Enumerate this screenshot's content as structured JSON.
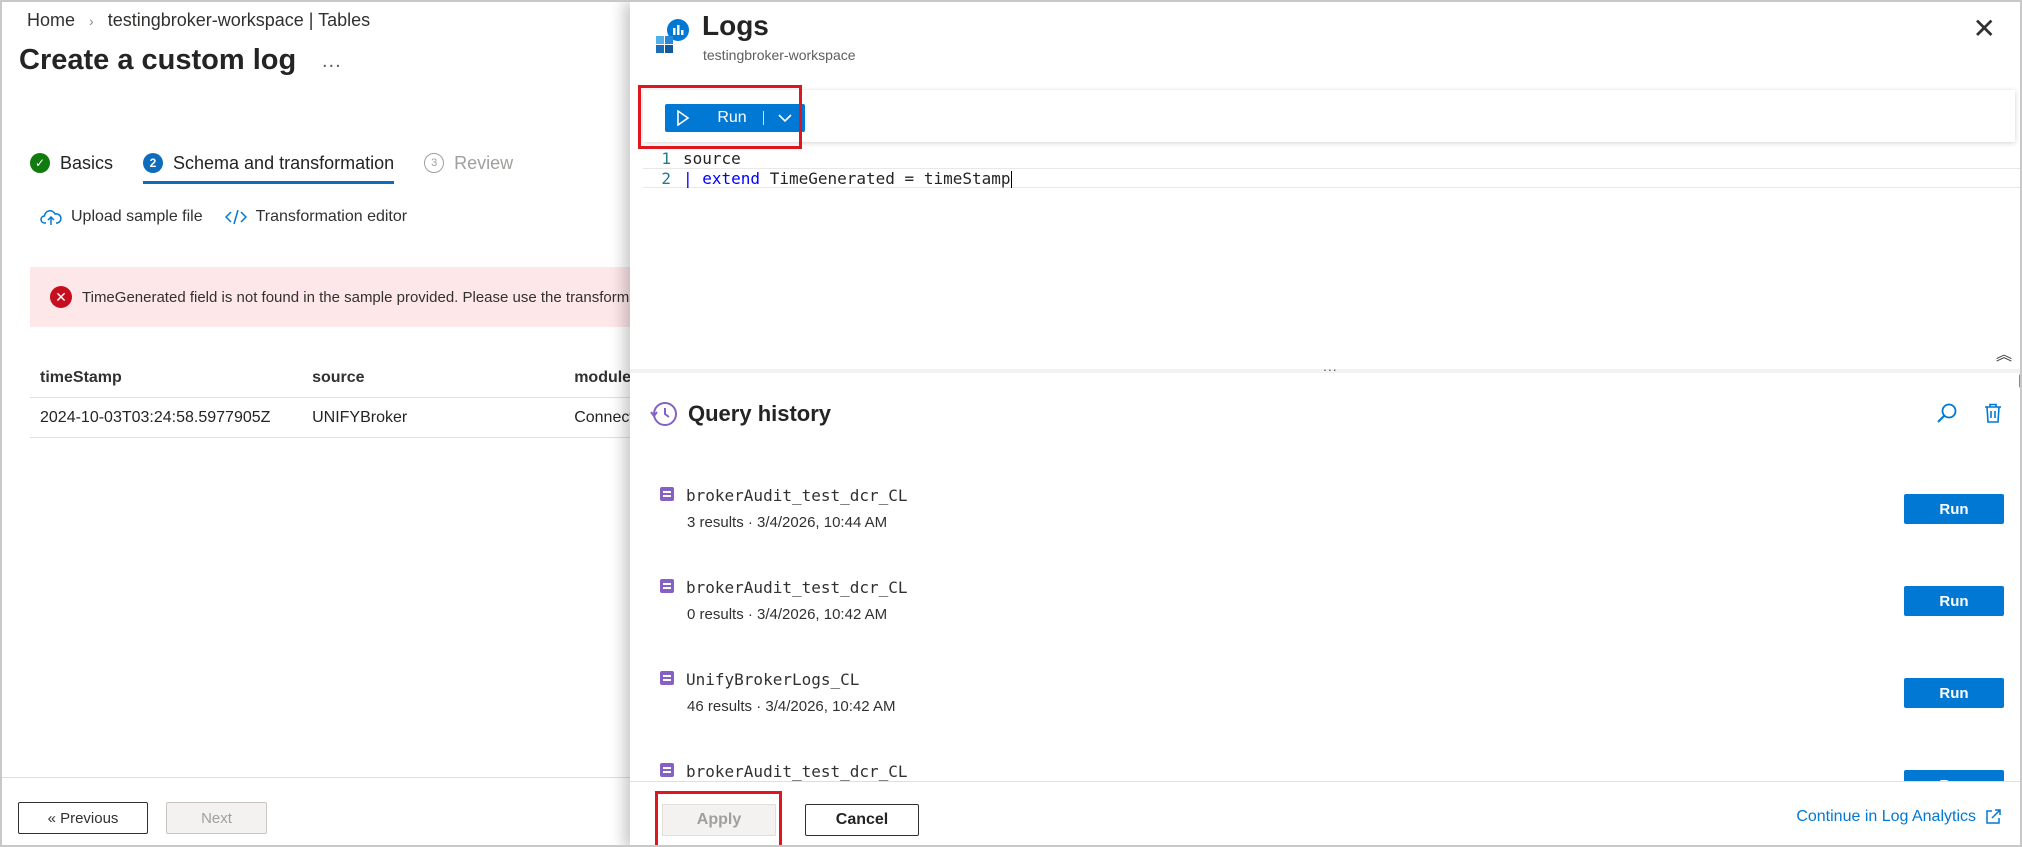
{
  "breadcrumb": {
    "home": "Home",
    "workspace": "testingbroker-workspace | Tables"
  },
  "page": {
    "title": "Create a custom log",
    "more": "..."
  },
  "tabs": [
    {
      "label": "Basics",
      "badge": "✓"
    },
    {
      "label": "Schema and transformation",
      "badge": "2"
    },
    {
      "label": "Review",
      "badge": "3"
    }
  ],
  "toolbar": {
    "upload_label": "Upload sample file",
    "transform_label": "Transformation editor"
  },
  "error": {
    "message": "TimeGenerated field is not found in the sample provided. Please use the transformation editor to populate the TimeGenerated field."
  },
  "grid": {
    "columns": [
      "timeStamp",
      "source",
      "module"
    ],
    "rows": [
      [
        "2024-10-03T03:24:58.5977905Z",
        "UNIFYBroker",
        "Connector"
      ]
    ]
  },
  "footer_left": {
    "previous_label": "« Previous",
    "next_label": "Next"
  },
  "logs": {
    "title": "Logs",
    "subtitle": "testingbroker-workspace",
    "close": "✕",
    "run_label": "Run",
    "editor": {
      "line1_num": "1",
      "line1_code": "source",
      "line2_num": "2",
      "line2_pipe": "| ",
      "line2_kw": "extend",
      "line2_rest": " TimeGenerated = timeStamp"
    },
    "splitter": "...",
    "collapse": "︽",
    "history_title": "Query history",
    "history": [
      {
        "name": "brokerAudit_test_dcr_CL",
        "meta": "3 results · 3/4/2026, 10:44 AM",
        "run": "Run"
      },
      {
        "name": "brokerAudit_test_dcr_CL",
        "meta": "0 results · 3/4/2026, 10:42 AM",
        "run": "Run"
      },
      {
        "name": "UnifyBrokerLogs_CL",
        "meta": "46 results · 3/4/2026, 10:42 AM",
        "run": "Run"
      },
      {
        "name": "brokerAudit_test_dcr_CL",
        "meta": "",
        "run": "Run"
      }
    ],
    "apply_label": "Apply",
    "cancel_label": "Cancel",
    "continue_label": "Continue in Log Analytics"
  },
  "colors": {
    "accent": "#0078d4",
    "error_bg": "#fde7e9",
    "highlight": "#e0161e",
    "success": "#107c10"
  }
}
